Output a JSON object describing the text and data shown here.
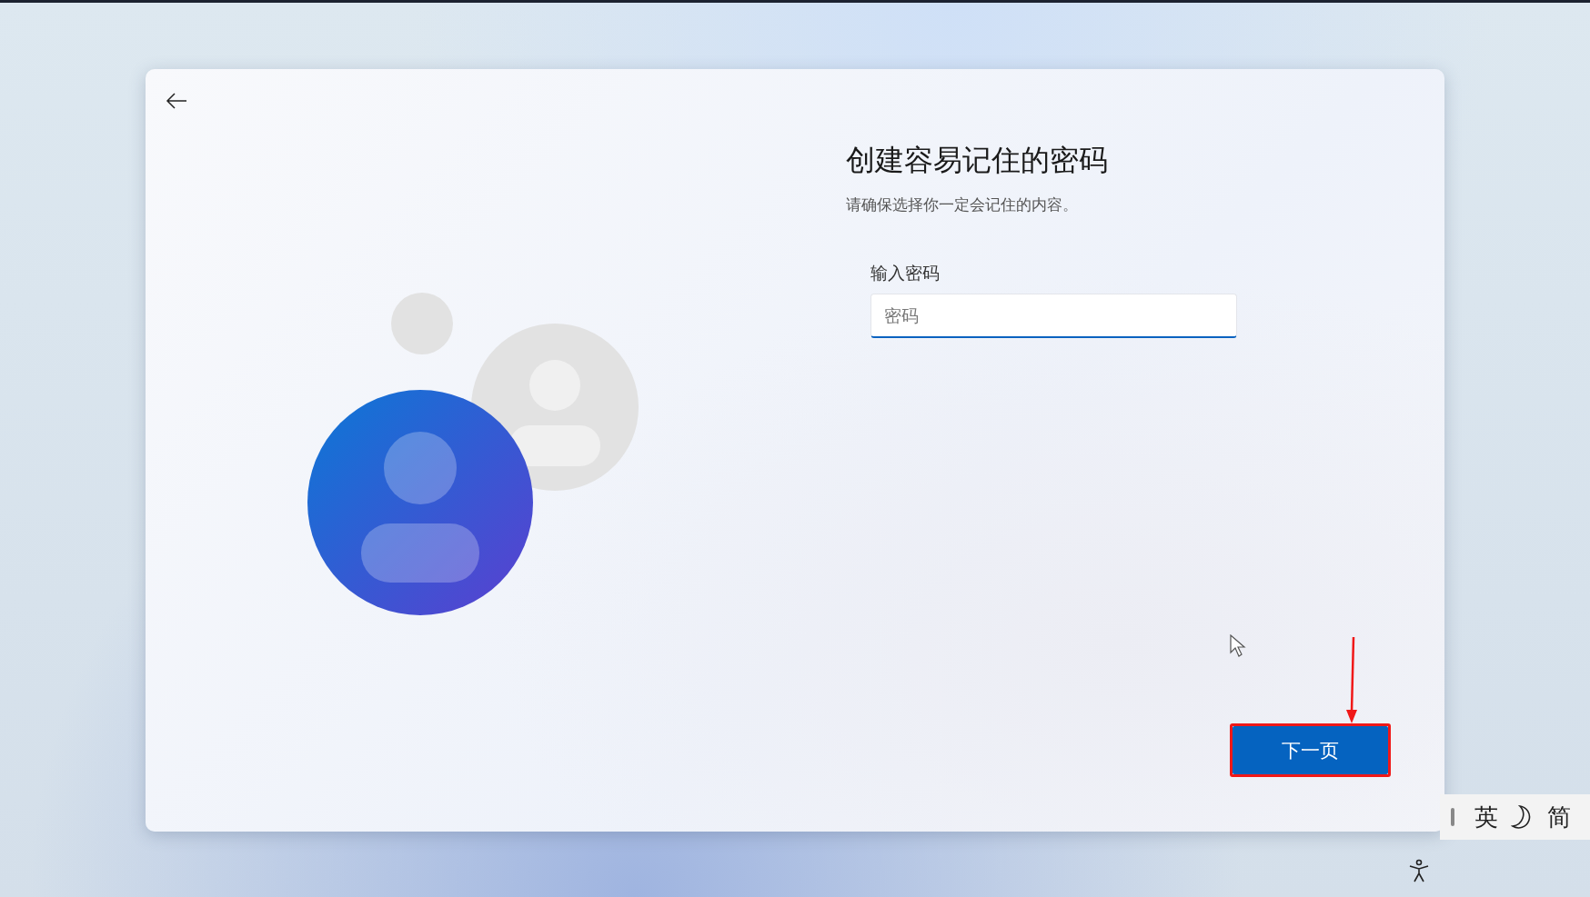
{
  "dialog": {
    "title": "创建容易记住的密码",
    "subtitle": "请确保选择你一定会记住的内容。",
    "password_field": {
      "label": "输入密码",
      "placeholder": "密码"
    },
    "next_button": {
      "label": "下一页"
    }
  },
  "ime_bar": {
    "items": [
      {
        "kind": "text",
        "label": "英"
      },
      {
        "kind": "moon"
      },
      {
        "kind": "text",
        "label": "简"
      }
    ]
  }
}
